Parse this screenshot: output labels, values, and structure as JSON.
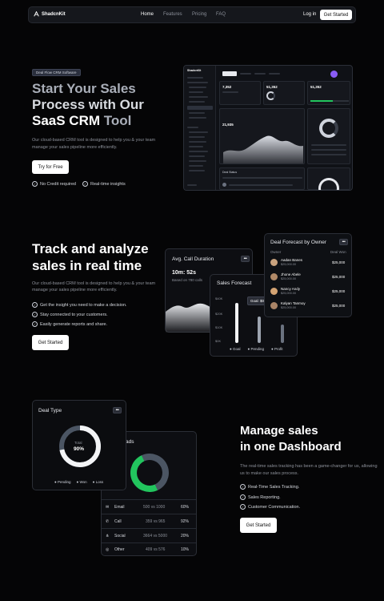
{
  "nav": {
    "brand": "ShadcnKit",
    "links": [
      {
        "label": "Home",
        "active": true
      },
      {
        "label": "Features",
        "active": false
      },
      {
        "label": "Pricing",
        "active": false
      },
      {
        "label": "FAQ",
        "active": false
      }
    ],
    "login": "Log in",
    "cta": "Get Started"
  },
  "hero": {
    "badge": "Deal Flow CRM Software",
    "title_line1": "Start Your Sales",
    "title_line2": "Process with Our",
    "title_line3a": "SaaS CRM",
    "title_line3b": "Tool",
    "description": "Our cloud-based CRM tool is designed to help you & your team manage your sales pipeline more efficiently.",
    "cta": "Try for Free",
    "checks": [
      "No Credit required",
      "Real-time insights"
    ]
  },
  "mock": {
    "brand": "ShadcnKit",
    "stats": [
      "7,352",
      "51,352",
      "51,352"
    ],
    "revenue": "21,935",
    "deal_status": "Deal Status"
  },
  "section2": {
    "title_line1": "Track and analyze",
    "title_line2": "sales in real time",
    "description": "Our cloud-based CRM tool is designed to help you & your team manage your sales pipeline more efficiently.",
    "checks": [
      "Get the insight you need to make a decision.",
      "Stay connected to your customers.",
      "Easily generate reports and share."
    ],
    "cta": "Get Started",
    "call_card": {
      "title": "Avg. Call Duration",
      "value": "10m: 52s",
      "sub": "Based on 780 calls",
      "more": "•••"
    },
    "forecast_card": {
      "title": "Sales Forecast",
      "tooltip": "Goal: $0",
      "y_ticks": [
        "$40K",
        "$20K",
        "$10K",
        "$0K"
      ],
      "legend": [
        "Goal",
        "Pending",
        "Profit"
      ]
    },
    "owner_card": {
      "title": "Deal Forecast by Owner",
      "more": "•••",
      "col_owner": "Owner",
      "col_won": "Deal Won",
      "rows": [
        {
          "name": "Aadan Banes",
          "sub": "$25,000.00",
          "won": "$25,000"
        },
        {
          "name": "Jhone Abele",
          "sub": "$25,000.00",
          "won": "$25,000"
        },
        {
          "name": "Nancy Andy",
          "sub": "$25,000.00",
          "won": "$25,000"
        },
        {
          "name": "Kalyan Tanmoy",
          "sub": "$25,000.00",
          "won": "$25,000"
        }
      ]
    }
  },
  "section3": {
    "title_line1": "Manage sales",
    "title_line2": "in one Dashboard",
    "description": "The real-time sales tracking has been a game-changer for us, allowing us to make our sales process.",
    "checks": [
      "Real-Time Sales Tracking.",
      "Sales Reporting.",
      "Customer Communication."
    ],
    "cta": "Get Started",
    "deal_type": {
      "title": "Deal Type",
      "more": "•••",
      "center_label": "Total",
      "center_value": "90%",
      "legend": [
        "Pending",
        "Won",
        "Loss"
      ]
    },
    "leads": {
      "title_fragment": "ads",
      "rows": [
        {
          "label": "Email",
          "range": "500 vs 1000",
          "pct": "60%"
        },
        {
          "label": "Call",
          "range": "359 vs 965",
          "pct": "92%"
        },
        {
          "label": "Social",
          "range": "3664 vs 5000",
          "pct": "20%"
        },
        {
          "label": "Other",
          "range": "409 vs 576",
          "pct": "10%"
        }
      ]
    }
  },
  "colors": {
    "accent_green": "#22c55e",
    "bg": "#050506"
  }
}
